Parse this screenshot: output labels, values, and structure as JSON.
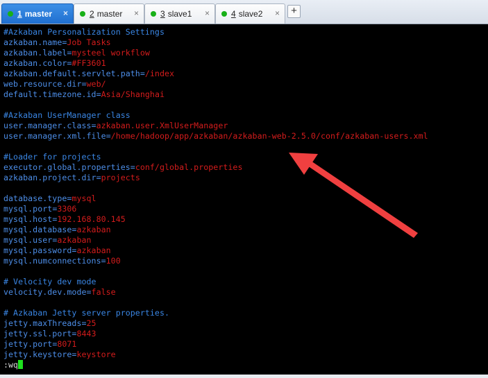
{
  "tabs": [
    {
      "num": "1",
      "label": "master",
      "active": true
    },
    {
      "num": "2",
      "label": "master",
      "active": false
    },
    {
      "num": "3",
      "label": "slave1",
      "active": false
    },
    {
      "num": "4",
      "label": "slave2",
      "active": false
    }
  ],
  "tab_close": "×",
  "add_tab": "+",
  "lines": [
    {
      "type": "comment",
      "text": "#Azkaban Personalization Settings"
    },
    {
      "type": "kv",
      "key": "azkaban.name",
      "value": "Job Tasks"
    },
    {
      "type": "kv",
      "key": "azkaban.label",
      "value": "mysteel workflow"
    },
    {
      "type": "kv",
      "key": "azkaban.color",
      "value": "#FF3601"
    },
    {
      "type": "kv",
      "key": "azkaban.default.servlet.path",
      "value": "/index"
    },
    {
      "type": "kv",
      "key": "web.resource.dir",
      "value": "web/"
    },
    {
      "type": "kv",
      "key": "default.timezone.id",
      "value": "Asia/Shanghai"
    },
    {
      "type": "blank"
    },
    {
      "type": "comment",
      "text": "#Azkaban UserManager class"
    },
    {
      "type": "kv",
      "key": "user.manager.class",
      "value": "azkaban.user.XmlUserManager"
    },
    {
      "type": "kv",
      "key": "user.manager.xml.file",
      "value": "/home/hadoop/app/azkaban/azkaban-web-2.5.0/conf/azkaban-users.xml"
    },
    {
      "type": "blank"
    },
    {
      "type": "comment",
      "text": "#Loader for projects"
    },
    {
      "type": "kv",
      "key": "executor.global.properties",
      "value": "conf/global.properties"
    },
    {
      "type": "kv",
      "key": "azkaban.project.dir",
      "value": "projects"
    },
    {
      "type": "blank"
    },
    {
      "type": "kv",
      "key": "database.type",
      "value": "mysql"
    },
    {
      "type": "kv",
      "key": "mysql.port",
      "value": "3306"
    },
    {
      "type": "kv",
      "key": "mysql.host",
      "value": "192.168.80.145"
    },
    {
      "type": "kv",
      "key": "mysql.database",
      "value": "azkaban"
    },
    {
      "type": "kv",
      "key": "mysql.user",
      "value": "azkaban"
    },
    {
      "type": "kv",
      "key": "mysql.password",
      "value": "azkaban"
    },
    {
      "type": "kv",
      "key": "mysql.numconnections",
      "value": "100"
    },
    {
      "type": "blank"
    },
    {
      "type": "comment",
      "text": "# Velocity dev mode"
    },
    {
      "type": "kv",
      "key": "velocity.dev.mode",
      "value": "false"
    },
    {
      "type": "blank"
    },
    {
      "type": "comment",
      "text": "# Azkaban Jetty server properties."
    },
    {
      "type": "kv",
      "key": "jetty.maxThreads",
      "value": "25"
    },
    {
      "type": "kv",
      "key": "jetty.ssl.port",
      "value": "8443"
    },
    {
      "type": "kv",
      "key": "jetty.port",
      "value": "8071"
    },
    {
      "type": "kv",
      "key": "jetty.keystore",
      "value": "keystore"
    },
    {
      "type": "command",
      "text": ":wq"
    }
  ],
  "colors": {
    "key": "#4d8ee8",
    "value": "#d41c1c",
    "comment": "#3a86e4",
    "cursor": "#1ee01e",
    "arrow": "#f04040",
    "active_tab": "#2a7bdc"
  }
}
